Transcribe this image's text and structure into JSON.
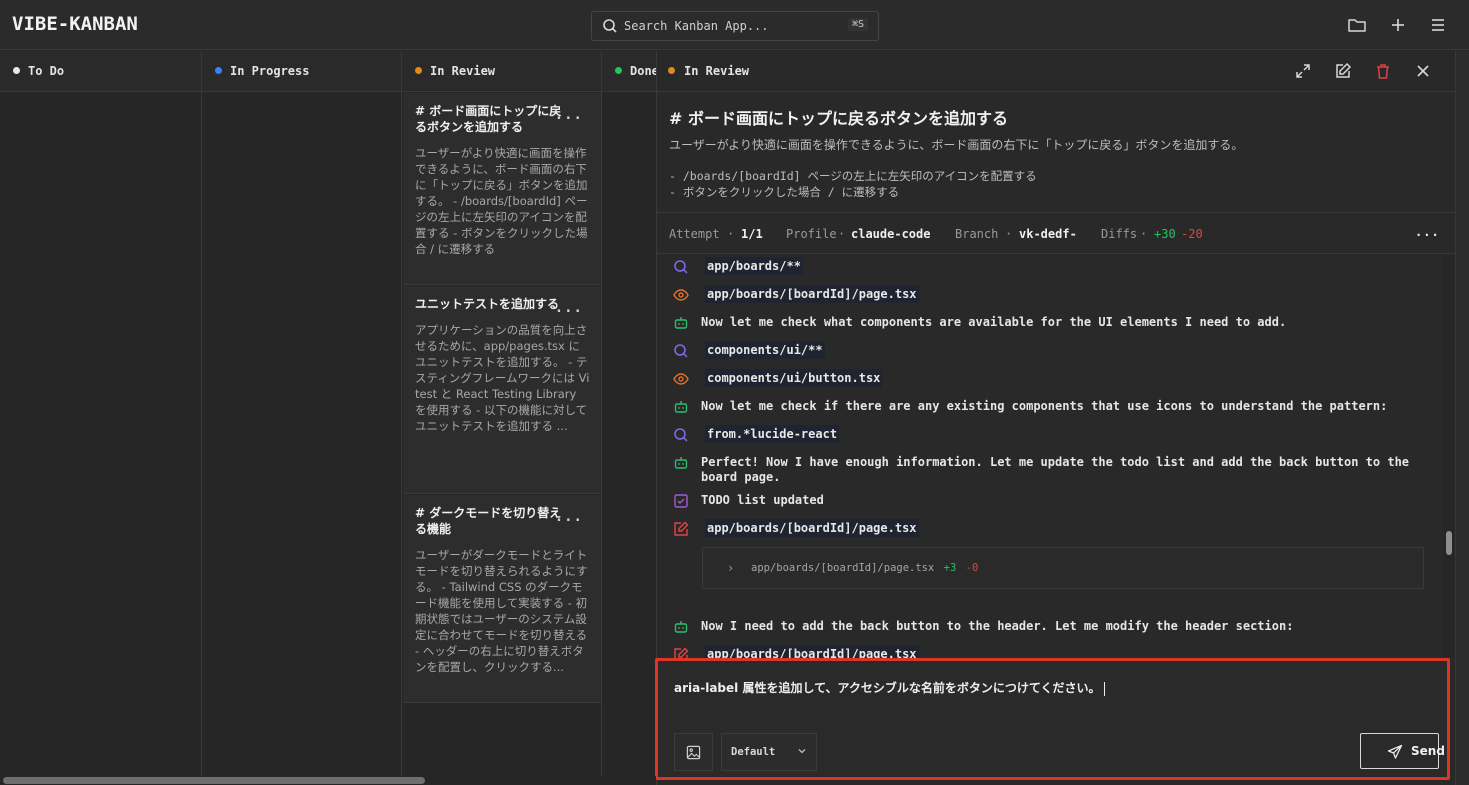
{
  "app": {
    "logo": "VIBE-KANBAN"
  },
  "search": {
    "placeholder": "Search Kanban App...",
    "shortcut": "⌘S"
  },
  "topbar_icons": [
    "folder-icon",
    "plus-icon",
    "menu-icon"
  ],
  "columns": [
    {
      "name": "To Do",
      "color": "#e8e8e8"
    },
    {
      "name": "In Progress",
      "color": "#3b82f6"
    },
    {
      "name": "In Review",
      "color": "#e08a1e"
    },
    {
      "name": "Done",
      "color": "#22c55e"
    }
  ],
  "cards": [
    {
      "title": "# ボード画面にトップに戻るボタンを追加する",
      "more": "...",
      "description": "ユーザーがより快適に画面を操作できるように、ボード画面の右下に「トップに戻る」ボタンを追加する。 - /boards/[boardId] ページの左上に左矢印のアイコンを配置する - ボタンをクリックした場合 / に遷移する"
    },
    {
      "title": "ユニットテストを追加する",
      "more": "...",
      "description": "アプリケーションの品質を向上させるために、app/pages.tsx にユニットテストを追加する。 - テスティングフレームワークには Vitest と React Testing Library を使用する - 以下の機能に対してユニットテストを追加する ..."
    },
    {
      "title": "# ダークモードを切り替える機能",
      "more": "...",
      "description": "ユーザーがダークモードとライトモードを切り替えられるようにする。 - Tailwind CSS のダークモード機能を使用して実装する - 初期状態ではユーザーのシステム設定に合わせてモードを切り替える - ヘッダーの右上に切り替えボタンを配置し、クリックする..."
    }
  ],
  "panel": {
    "status": "In Review",
    "status_color": "#e08a1e",
    "task_title": "# ボード画面にトップに戻るボタンを追加する",
    "task_description": "ユーザーがより快適に画面を操作できるように、ボード画面の右下に「トップに戻る」ボタンを追加する。",
    "task_bullets": [
      "- /boards/[boardId] ページの左上に左矢印のアイコンを配置する",
      "- ボタンをクリックした場合 / に遷移する"
    ],
    "meta": {
      "attempt_label": "Attempt",
      "attempt_value": "1/1",
      "profile_label": "Profile",
      "profile_value": "claude-code",
      "branch_label": "Branch",
      "branch_value": "vk-dedf-",
      "diffs_label": "Diffs",
      "diffs_add": "+30",
      "diffs_del": "-20",
      "sep": "·",
      "more": "..."
    },
    "log": [
      {
        "kind": "search",
        "text": "app/boards/**",
        "code": true
      },
      {
        "kind": "read",
        "text": "app/boards/[boardId]/page.tsx",
        "code": true
      },
      {
        "kind": "agent",
        "text": "Now let me check what components are available for the UI elements I need to add.",
        "code": false
      },
      {
        "kind": "search",
        "text": "components/ui/**",
        "code": true
      },
      {
        "kind": "read",
        "text": "components/ui/button.tsx",
        "code": true
      },
      {
        "kind": "agent",
        "text": "Now let me check if there are any existing components that use icons to understand the pattern:",
        "code": false
      },
      {
        "kind": "search",
        "text": "from.*lucide-react",
        "code": true
      },
      {
        "kind": "agent",
        "text": "Perfect! Now I have enough information. Let me update the todo list and add the back button to the board page.",
        "code": false
      },
      {
        "kind": "todo",
        "text": "TODO list updated",
        "code": false
      },
      {
        "kind": "edit",
        "text": "app/boards/[boardId]/page.tsx",
        "code": true
      },
      {
        "kind": "agent",
        "text": "Now I need to add the back button to the header. Let me modify the header section:",
        "code": false
      },
      {
        "kind": "edit",
        "text": "app/boards/[boardId]/page.tsx",
        "code": true
      }
    ],
    "diff_file": {
      "chevron": "›",
      "name": "app/boards/[boardId]/page.tsx",
      "add": "+3",
      "del": "-0"
    }
  },
  "composer": {
    "value": "aria-label 属性を追加して、アクセシブルな名前をボタンにつけてください。",
    "profile_select": "Default",
    "send_label": "Send"
  },
  "colors": {
    "search_icon": "#7c6cf0",
    "read_icon": "#e0702a",
    "agent_icon": "#2bbf6a",
    "todo_icon": "#a35ad6",
    "edit_icon": "#e04545",
    "diff_add": "#22c55e",
    "diff_del": "#e04545",
    "highlight": "#e03524"
  }
}
